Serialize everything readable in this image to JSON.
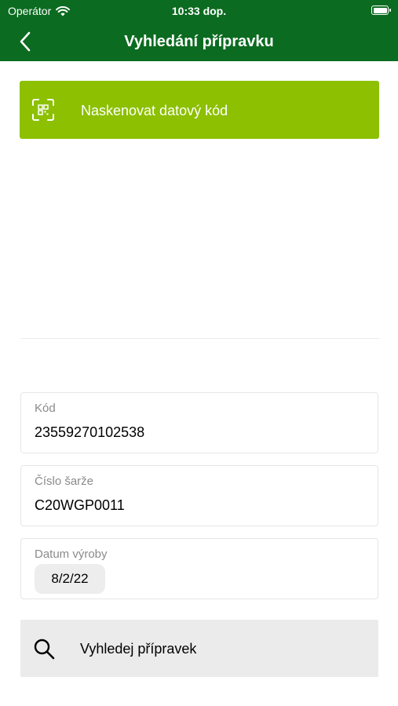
{
  "status_bar": {
    "carrier": "Operátor",
    "time": "10:33 dop."
  },
  "nav": {
    "title": "Vyhledání přípravku"
  },
  "scan": {
    "label": "Naskenovat datový kód"
  },
  "fields": {
    "code": {
      "label": "Kód",
      "value": "23559270102538"
    },
    "batch": {
      "label": "Číslo šarže",
      "value": "C20WGP0011"
    },
    "date": {
      "label": "Datum výroby",
      "value": "8/2/22"
    }
  },
  "search": {
    "label": "Vyhledej přípravek"
  },
  "colors": {
    "header_bg": "#0b6b20",
    "scan_bg": "#8cc000",
    "search_bg": "#ebebeb"
  }
}
